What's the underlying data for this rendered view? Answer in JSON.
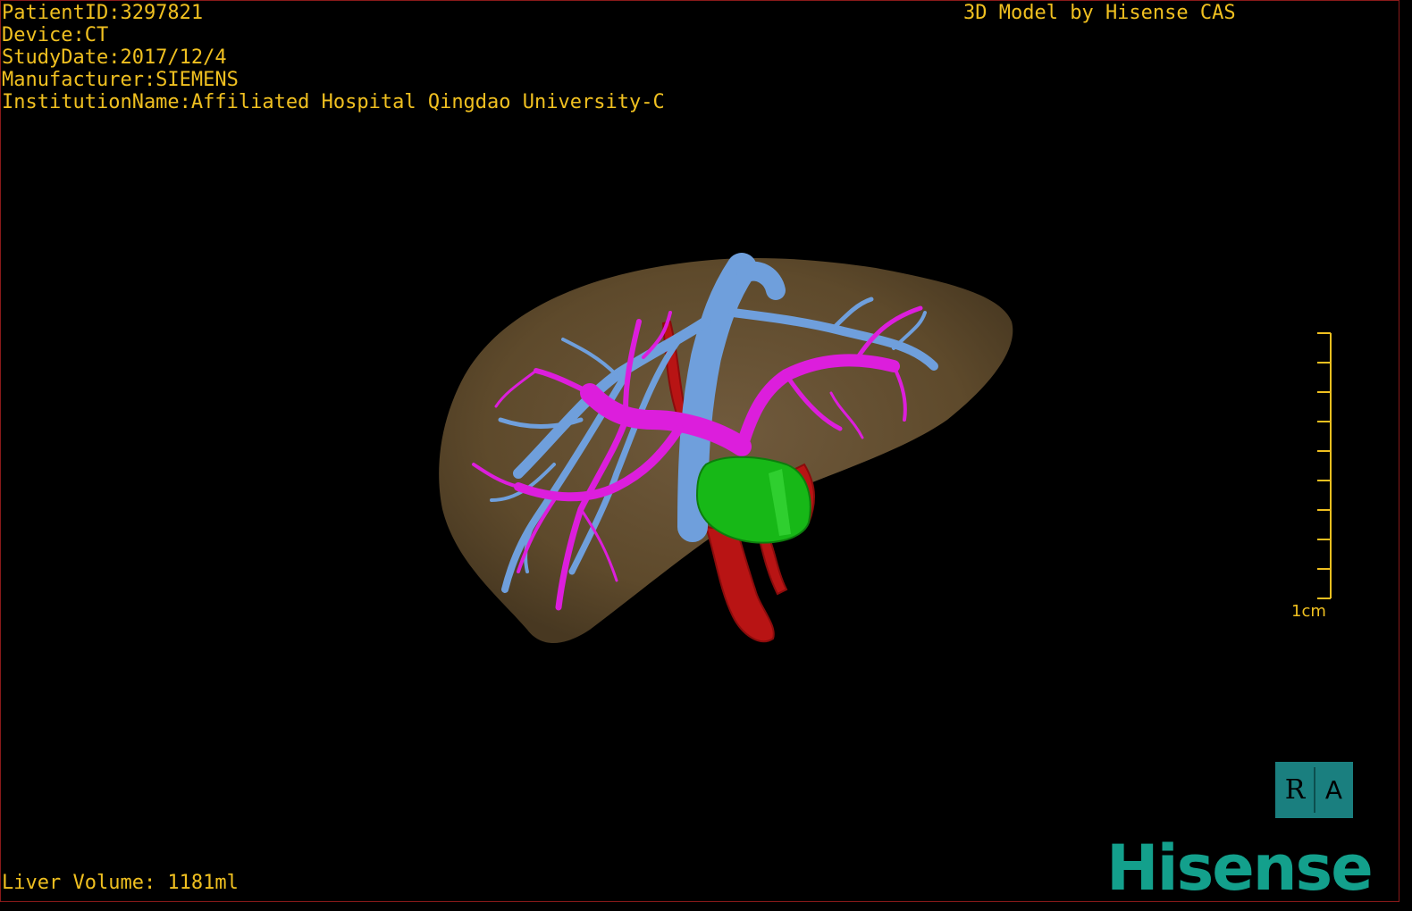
{
  "header": {
    "patient_id": "PatientID:3297821",
    "device": "Device:CT",
    "study_date": "StudyDate:2017/12/4",
    "manufacturer": "Manufacturer:SIEMENS",
    "institution": "InstitutionName:Affiliated Hospital Qingdao University-C",
    "model_credit": "3D Model by Hisense CAS"
  },
  "footer": {
    "liver_volume": "Liver Volume: 1181ml"
  },
  "scale_bar": {
    "label": "1cm"
  },
  "orientation": {
    "left_glyph": "R",
    "right_glyph": "A"
  },
  "logo": {
    "text": "Hisense"
  },
  "colors": {
    "text": "#f0c020",
    "liver": "#6b5232",
    "portal_vein": "#e020e0",
    "hepatic_vein": "#6fa0e0",
    "artery": "#c01818",
    "tumor": "#18c018",
    "brand": "#13a08c"
  }
}
